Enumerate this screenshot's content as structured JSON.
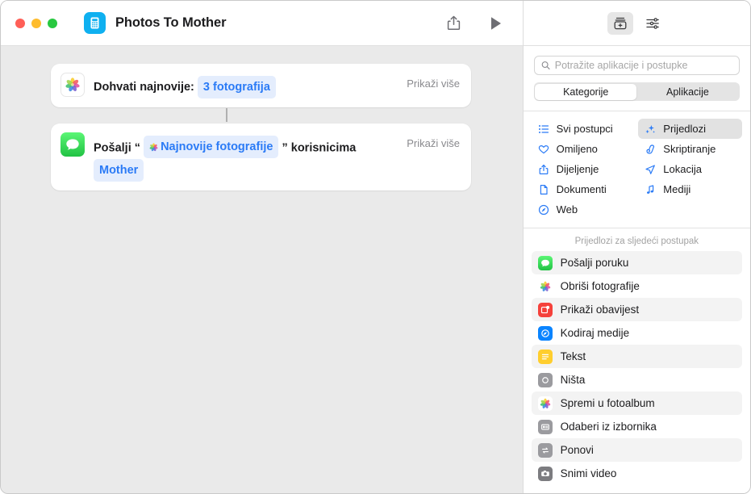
{
  "window": {
    "title": "Photos To Mother",
    "app_icon": "shortcuts-app-icon",
    "traffic_lights": [
      "close-button",
      "minimize-button",
      "zoom-button"
    ],
    "toolbar": {
      "share_label": "share-icon",
      "run_label": "run-play-icon"
    }
  },
  "editor": {
    "actions": [
      {
        "icon": "photos-app-icon",
        "prefix": "Dohvati najnovije:",
        "token": "3 fotografija",
        "token_icon": "",
        "suffix": "",
        "second_line": "",
        "show_more": "Prikaži više"
      },
      {
        "icon": "messages-app-icon",
        "prefix": "Pošalji “",
        "token": "Najnovije fotografije",
        "token_icon": "photos-flower-icon",
        "suffix": "” korisnicima",
        "second_line": "Mother",
        "show_more": "Prikaži više"
      }
    ]
  },
  "panel": {
    "toolbar_buttons": [
      {
        "name": "action-library-icon",
        "selected": true
      },
      {
        "name": "shortcut-details-sliders-icon",
        "selected": false
      }
    ],
    "search": {
      "placeholder": "Potražite aplikacije i postupke",
      "value": "",
      "icon": "search-icon"
    },
    "segments": [
      {
        "label": "Kategorije",
        "selected": true
      },
      {
        "label": "Aplikacije",
        "selected": false
      }
    ],
    "categories": [
      {
        "label": "Svi postupci",
        "icon": "list-bullet-icon",
        "selected": false
      },
      {
        "label": "Prijedlozi",
        "icon": "sparkles-icon",
        "selected": true
      },
      {
        "label": "Omiljeno",
        "icon": "heart-icon",
        "selected": false
      },
      {
        "label": "Skriptiranje",
        "icon": "scroll-icon",
        "selected": false
      },
      {
        "label": "Dijeljenje",
        "icon": "share-icon",
        "selected": false
      },
      {
        "label": "Lokacija",
        "icon": "location-arrow-icon",
        "selected": false
      },
      {
        "label": "Dokumenti",
        "icon": "document-icon",
        "selected": false
      },
      {
        "label": "Mediji",
        "icon": "music-note-icon",
        "selected": false
      },
      {
        "label": "Web",
        "icon": "compass-icon",
        "selected": false
      }
    ],
    "suggestions_header": "Prijedlozi za sljedeći postupak",
    "suggestions": [
      {
        "label": "Pošalji poruku",
        "icon": "messages-app-icon"
      },
      {
        "label": "Obriši fotografije",
        "icon": "photos-app-icon"
      },
      {
        "label": "Prikaži obavijest",
        "icon": "notification-icon"
      },
      {
        "label": "Kodiraj medije",
        "icon": "encode-media-icon"
      },
      {
        "label": "Tekst",
        "icon": "text-icon"
      },
      {
        "label": "Ništa",
        "icon": "nothing-circle-icon"
      },
      {
        "label": "Spremi u fotoalbum",
        "icon": "photos-app-icon"
      },
      {
        "label": "Odaberi iz izbornika",
        "icon": "menu-card-icon"
      },
      {
        "label": "Ponovi",
        "icon": "repeat-icon"
      },
      {
        "label": "Snimi video",
        "icon": "camera-icon"
      }
    ]
  },
  "colors": {
    "accent_blue": "#2b7bf6",
    "token_bg": "#e4edfd",
    "canvas_bg": "#eaeaea",
    "messages_green": "#21c244",
    "notification_red": "#f5413b",
    "text_yellow": "#ffce2e",
    "encode_blue": "#0a84ff",
    "app_icon_cyan": "#0fb0f0"
  }
}
